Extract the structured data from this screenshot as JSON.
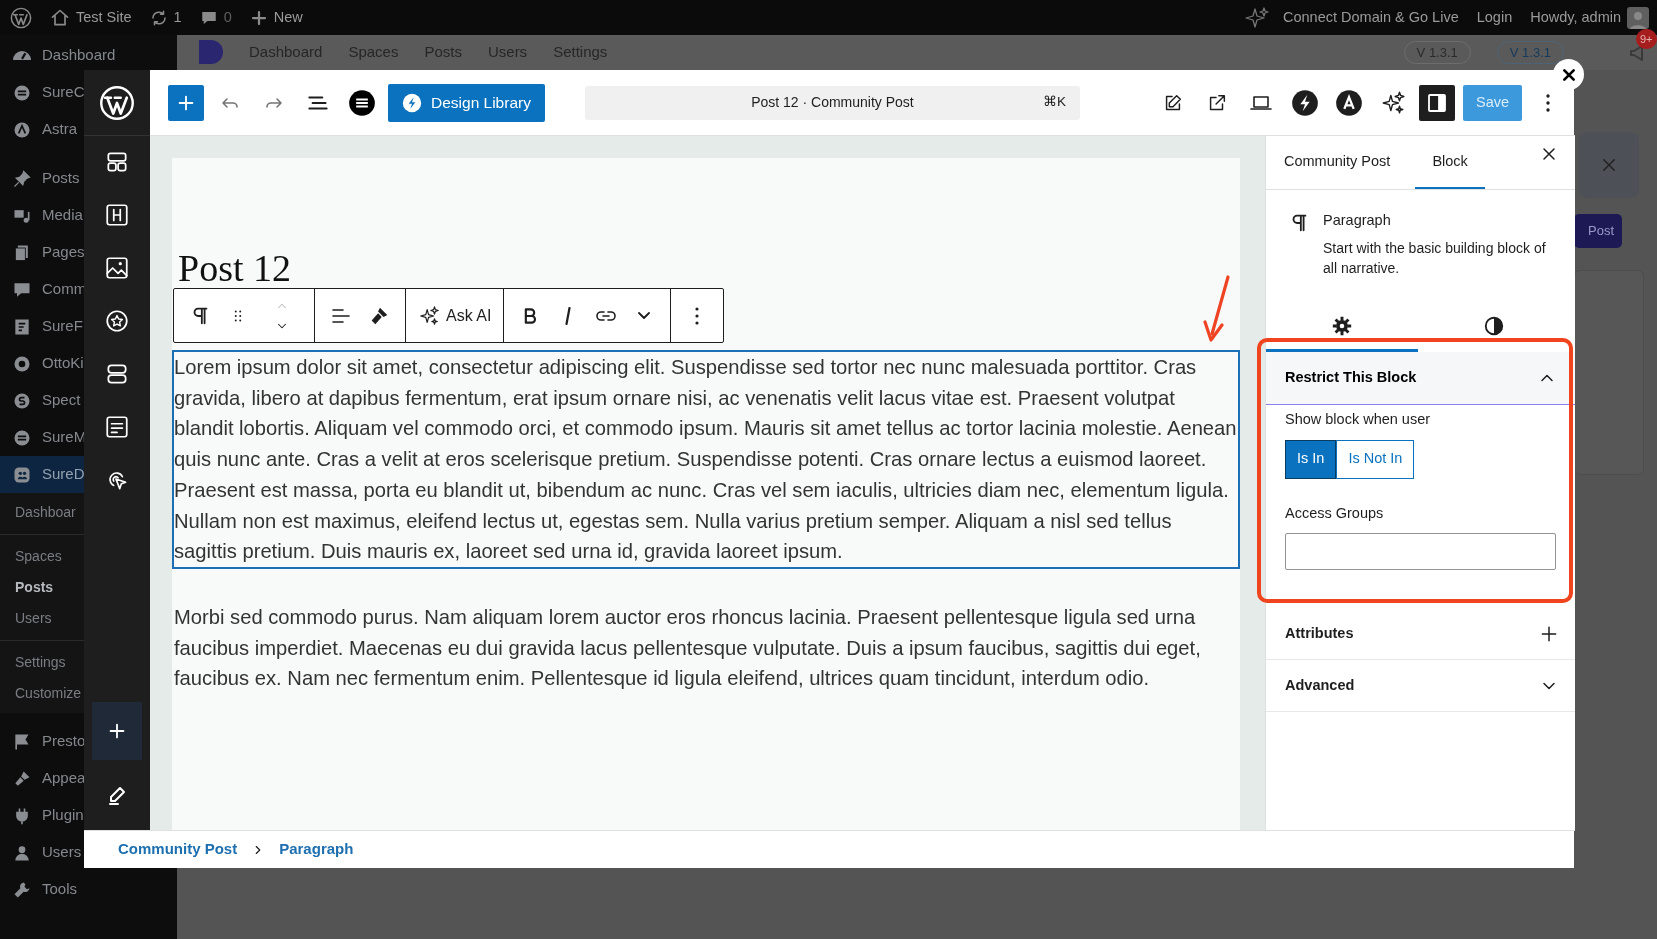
{
  "admin_bar": {
    "site": "Test Site",
    "updates": "1",
    "comments": "0",
    "new": "New",
    "connect": "Connect Domain & Go Live",
    "login": "Login",
    "greeting": "Howdy, admin"
  },
  "admin_menu": {
    "groups": [
      {
        "items": [
          {
            "label": "Dashboard",
            "selected": false
          },
          {
            "label": "SureC",
            "selected": false
          },
          {
            "label": "Astra",
            "selected": false
          }
        ]
      },
      {
        "items": [
          {
            "label": "Posts",
            "selected": false
          },
          {
            "label": "Media",
            "selected": false
          },
          {
            "label": "Pages",
            "selected": false
          },
          {
            "label": "Comm",
            "selected": false
          },
          {
            "label": "SureF",
            "selected": false
          },
          {
            "label": "OttoKi",
            "selected": false
          },
          {
            "label": "Spect",
            "selected": false
          },
          {
            "label": "SureM",
            "selected": false
          },
          {
            "label": "SureD",
            "selected": true
          }
        ]
      }
    ],
    "submenu": [
      {
        "items": [
          {
            "label": "Dashboar",
            "selected": false
          }
        ]
      },
      {
        "items": [
          {
            "label": "Spaces",
            "selected": false
          },
          {
            "label": "Posts",
            "selected": true
          },
          {
            "label": "Users",
            "selected": false
          }
        ]
      },
      {
        "items": [
          {
            "label": "Settings",
            "selected": false
          },
          {
            "label": "Customize",
            "selected": false
          }
        ]
      }
    ],
    "after": [
      {
        "label": "Presto",
        "selected": false
      },
      {
        "label": "Appea",
        "selected": false
      },
      {
        "label": "Plugin",
        "selected": false
      },
      {
        "label": "Users",
        "selected": false
      },
      {
        "label": "Tools",
        "selected": false
      }
    ]
  },
  "behind_page": {
    "nav": [
      "Dashboard",
      "Spaces",
      "Posts",
      "Users",
      "Settings"
    ],
    "versions": [
      "V 1.3.1",
      "V 1.3.1"
    ],
    "notification_count": "9+",
    "button": "Post"
  },
  "editor": {
    "design_library": "Design Library",
    "command": "Post 12 · Community Post",
    "shortcut": "⌘K",
    "save": "Save",
    "sidebar_open": true,
    "title": "Post 12",
    "ask_ai": "Ask AI",
    "paragraphs": [
      {
        "text": "Lorem ipsum dolor sit amet, consectetur adipiscing elit. Suspendisse sed tortor nec nunc malesuada porttitor. Cras gravida, libero at dapibus fermentum, erat ipsum ornare nisi, ac venenatis velit lacus vitae est. Praesent volutpat blandit lobortis. Aliquam vel commodo orci, et commodo ipsum. Mauris sit amet tellus ac tortor lacinia molestie. Aenean quis nunc ante. Cras a velit at eros scelerisque pretium. Suspendisse potenti. Cras ornare lectus a euismod laoreet. Praesent est massa, porta eu blandit ut, bibendum ac nunc. Cras vel sem iaculis, ultricies diam nec, elementum ligula. Nullam non est maximus, eleifend lectus ut, egestas sem. Nulla varius pretium semper. Aliquam a nisl sed tellus sagittis pretium. Duis mauris ex, laoreet sed urna id, gravida laoreet ipsum.",
        "selected": true
      },
      {
        "text": "Morbi sed commodo purus. Nam aliquam lorem auctor eros rhoncus lacinia. Praesent pellentesque ligula sed urna faucibus imperdiet. Maecenas eu dui gravida lacus pellentesque vulputate. Duis a ipsum faucibus, sagittis dui eget, faucibus ex. Nam nec fermentum enim. Pellentesque id ligula eleifend, ultrices quam tincidunt, interdum odio.",
        "selected": false
      }
    ],
    "breadcrumb": [
      "Community Post",
      "Paragraph"
    ]
  },
  "sidebar": {
    "tabs": [
      {
        "label": "Community Post",
        "selected": false
      },
      {
        "label": "Block",
        "selected": true
      }
    ],
    "block": {
      "title": "Paragraph",
      "description": "Start with the basic building block of all narrative."
    },
    "panel_tabs": [
      {
        "selected": true
      },
      {
        "selected": false
      }
    ],
    "restrict": {
      "title": "Restrict This Block",
      "expanded": true,
      "show_label": "Show block when user",
      "options": [
        {
          "label": "Is In",
          "selected": true
        },
        {
          "label": "Is Not In",
          "selected": false
        }
      ],
      "groups_label": "Access Groups"
    },
    "sections": [
      {
        "title": "Attributes",
        "kind": "plus"
      },
      {
        "title": "Advanced",
        "kind": "chevron"
      }
    ]
  }
}
